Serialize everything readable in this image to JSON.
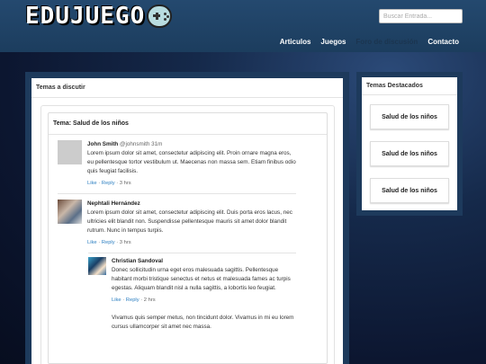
{
  "header": {
    "logo_text": "EDUJUEGO",
    "logo_icon": "gamepad-icon",
    "search_placeholder": "Buscar Entrada...",
    "nav": [
      {
        "label": "Articulos",
        "active": false
      },
      {
        "label": "Juegos",
        "active": false
      },
      {
        "label": "Foro de discusión",
        "active": true
      },
      {
        "label": "Contacto",
        "active": false
      }
    ]
  },
  "main": {
    "panel_title": "Temas a discutir",
    "topic_title": "Tema: Salud de los niños",
    "comments": [
      {
        "name": "John Smith",
        "handle": "@johnsmith",
        "time_inline": "31m",
        "text": "Lorem ipsum dolor sit amet, consectetur adipiscing elit. Proin ornare magna eros, eu pellentesque tortor vestibulum ut. Maecenas non massa sem. Etiam finibus odio quis feugiat facilisis.",
        "like": "Like",
        "reply": "Reply",
        "time": "3 hrs"
      },
      {
        "name": "Nephtali Hernández",
        "text": "Lorem ipsum dolor sit amet, consectetur adipiscing elit. Duis porta eros lacus, nec ultricies elit blandit non. Suspendisse pellentesque mauris sit amet dolor blandit rutrum. Nunc in tempus turpis.",
        "like": "Like",
        "reply": "Reply",
        "time": "3 hrs"
      },
      {
        "name": "Christian Sandoval",
        "text": "Donec sollicitudin urna eget eros malesuada sagittis. Pellentesque habitant morbi tristique senectus et netus et malesuada fames ac turpis egestas. Aliquam blandit nisl a nulla sagittis, a lobortis leo feugiat.",
        "like": "Like",
        "reply": "Reply",
        "time": "2 hrs"
      },
      {
        "text": "Vivamus quis semper metus, non tincidunt dolor. Vivamus in mi eu lorem cursus ullamcorper sit amet nec massa."
      }
    ]
  },
  "sidebar": {
    "title": "Temas Destacados",
    "items": [
      "Salud de los niños",
      "Salud de los niños",
      "Salud de los niños"
    ]
  },
  "colors": {
    "header_bg": "#1c3d5e",
    "panel_border": "#1d3a5c",
    "link": "#2c7fc1",
    "active_nav": "#1b3550"
  }
}
